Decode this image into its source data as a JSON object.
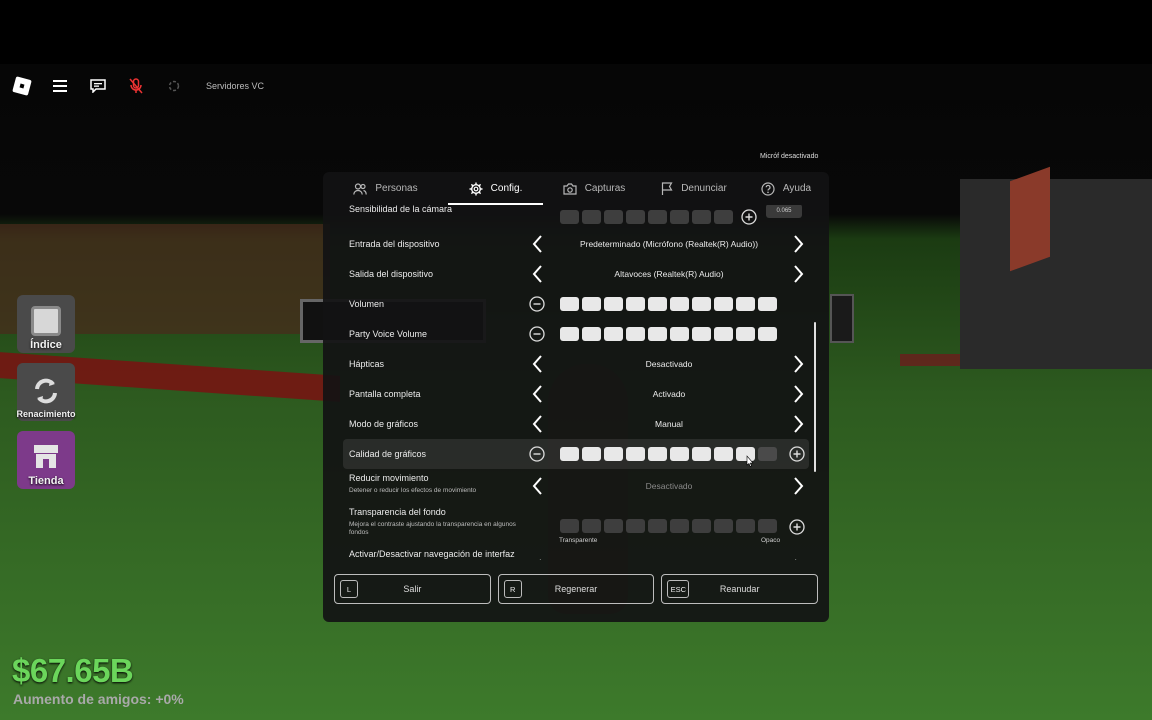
{
  "hud": {
    "server_label": "Servidores VC",
    "icons": [
      "roblox-logo-icon",
      "menu-icon",
      "chat-icon",
      "microphone-muted-icon",
      "spinner-icon"
    ]
  },
  "side_buttons": [
    {
      "label": "Índice",
      "icon": "book-icon",
      "color": "#5c5c5c"
    },
    {
      "label": "Renacimiento",
      "icon": "respawn-icon",
      "color": "#4b4b4b"
    },
    {
      "label": "Tienda",
      "icon": "shop-icon",
      "color": "#7d3a8a"
    }
  ],
  "stats": {
    "money": "$67.65B",
    "friends_boost": "Aumento de amigos: +0%"
  },
  "mic_tip": "Micróf desactivado",
  "menu": {
    "tabs": [
      {
        "label": "Personas",
        "icon": "people-icon",
        "active": false
      },
      {
        "label": "Config.",
        "icon": "gear-icon",
        "active": true
      },
      {
        "label": "Capturas",
        "icon": "camera-icon",
        "active": false
      },
      {
        "label": "Denunciar",
        "icon": "flag-icon",
        "active": false
      },
      {
        "label": "Ayuda",
        "icon": "help-icon",
        "active": false
      }
    ],
    "settings": [
      {
        "label": "Sensibilidad de la cámara",
        "type": "slider",
        "value": "0.065",
        "level": 0
      },
      {
        "label": "Entrada del dispositivo",
        "type": "select",
        "value": "Predeterminado (Micrófono (Realtek(R) Audio))"
      },
      {
        "label": "Salida del dispositivo",
        "type": "select",
        "value": "Altavoces (Realtek(R) Audio)"
      },
      {
        "label": "Volumen",
        "type": "slider",
        "level": 10
      },
      {
        "label": "Party Voice Volume",
        "type": "slider",
        "level": 10
      },
      {
        "label": "Hápticas",
        "type": "select",
        "value": "Desactivado"
      },
      {
        "label": "Pantalla completa",
        "type": "select",
        "value": "Activado"
      },
      {
        "label": "Modo de gráficos",
        "type": "select",
        "value": "Manual"
      },
      {
        "label": "Calidad de gráficos",
        "type": "slider",
        "level": 9,
        "highlighted": true
      },
      {
        "label": "Reducir movimiento",
        "type": "select",
        "value": "Desactivado",
        "description": "Detener o reducir los efectos de movimiento"
      },
      {
        "label": "Transparencia del fondo",
        "type": "slider",
        "level": 0,
        "description": "Mejora el contraste ajustando la transparencia en algunos fondos",
        "min_label": "Transparente",
        "max_label": "Opaco"
      },
      {
        "label": "Activar/Desactivar navegación de interfaz",
        "type": "select"
      }
    ],
    "buttons": [
      {
        "key": "L",
        "label": "Salir"
      },
      {
        "key": "R",
        "label": "Regenerar"
      },
      {
        "key": "ESC",
        "label": "Reanudar"
      }
    ]
  }
}
